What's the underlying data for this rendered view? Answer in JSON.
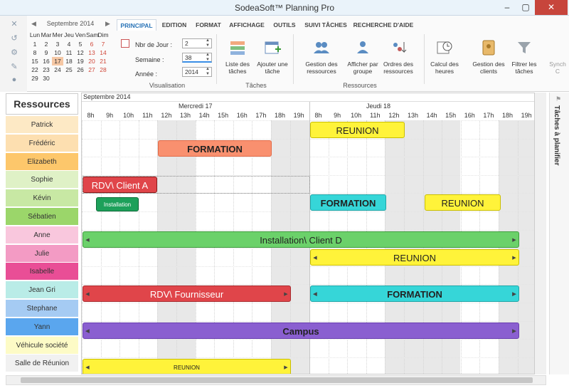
{
  "title": "SodeaSoft™ Planning Pro",
  "window_buttons": [
    "–",
    "▢",
    "✕"
  ],
  "calendar": {
    "title": "Septembre 2014",
    "prev": "◀",
    "next": "▶",
    "days": [
      "Lun",
      "Mar",
      "Mer",
      "Jeu",
      "Ven",
      "Sam",
      "Dim"
    ],
    "weeks": [
      [
        "1",
        "2",
        "3",
        "4",
        "5",
        "6",
        "7"
      ],
      [
        "8",
        "9",
        "10",
        "11",
        "12",
        "13",
        "14"
      ],
      [
        "15",
        "16",
        "17",
        "18",
        "19",
        "20",
        "21"
      ],
      [
        "22",
        "23",
        "24",
        "25",
        "26",
        "27",
        "28"
      ],
      [
        "29",
        "30",
        "",
        "",
        "",
        "",
        ""
      ]
    ]
  },
  "tabs": [
    "PRINCIPAL",
    "EDITION",
    "FORMAT",
    "AFFICHAGE",
    "OUTILS",
    "SUIVI TÂCHES",
    "RECHERCHE D'AIDE"
  ],
  "visu": {
    "nbjour_label": "Nbr de Jour :",
    "nbjour_value": "2",
    "semaine_label": "Semaine :",
    "semaine_value": "38",
    "annee_label": "Année :",
    "annee_value": "2014",
    "group": "Visualisation"
  },
  "ribbon": {
    "liste": "Liste des tâches",
    "ajouter": "Ajouter une tâche",
    "taches_group": "Tâches",
    "gestion_res": "Gestion des ressources",
    "afficher": "Afficher par groupe",
    "ordres": "Ordres des ressources",
    "res_group": "Ressources",
    "calcul": "Calcul des heures",
    "clients": "Gestion des clients",
    "filtrer": "Filtrer les tâches",
    "sync": "Synch C"
  },
  "resources_title": "Ressources",
  "resources": [
    {
      "name": "Patrick",
      "color": "#fde9c5"
    },
    {
      "name": "Frédéric",
      "color": "#fddfb0"
    },
    {
      "name": "Elizabeth",
      "color": "#fdc76b"
    },
    {
      "name": "Sophie",
      "color": "#dff1c6"
    },
    {
      "name": "Kévin",
      "color": "#c8e8a4"
    },
    {
      "name": "Sébatien",
      "color": "#9bd66a"
    },
    {
      "name": "Anne",
      "color": "#f9c7dd"
    },
    {
      "name": "Julie",
      "color": "#f39bc4"
    },
    {
      "name": "Isabelle",
      "color": "#e94e96"
    },
    {
      "name": "Jean Gri",
      "color": "#b9ece7"
    },
    {
      "name": "Stephane",
      "color": "#a5cbf3"
    },
    {
      "name": "Yann",
      "color": "#5aa6ee"
    },
    {
      "name": "Véhicule société",
      "color": "#fdfbc6"
    },
    {
      "name": "Salle de Réunion",
      "color": "#f1f1f1"
    }
  ],
  "planning": {
    "month": "Septembre 2014",
    "day1": "Mercredi 17",
    "day2": "Jeudi 18",
    "hours": [
      "8h",
      "9h",
      "10h",
      "11h",
      "12h",
      "13h",
      "14h",
      "15h",
      "16h",
      "17h",
      "18h",
      "19h",
      "8h",
      "9h",
      "10h",
      "11h",
      "12h",
      "13h",
      "14h",
      "15h",
      "16h",
      "17h",
      "18h",
      "19h"
    ]
  },
  "tasks": [
    {
      "label": "REUNION"
    },
    {
      "label": "FORMATION"
    },
    {
      "label": "RDV\\ Client A"
    },
    {
      "label": "Installation Client D"
    },
    {
      "label": "FORMATION"
    },
    {
      "label": "REUNION"
    },
    {
      "label": "Installation\\ Client D"
    },
    {
      "label": "REUNION"
    },
    {
      "label": "RDV\\ Fournisseur"
    },
    {
      "label": "FORMATION"
    },
    {
      "label": "Campus"
    },
    {
      "label": "REUNION"
    }
  ],
  "side_panel": "Tâches à planifier"
}
